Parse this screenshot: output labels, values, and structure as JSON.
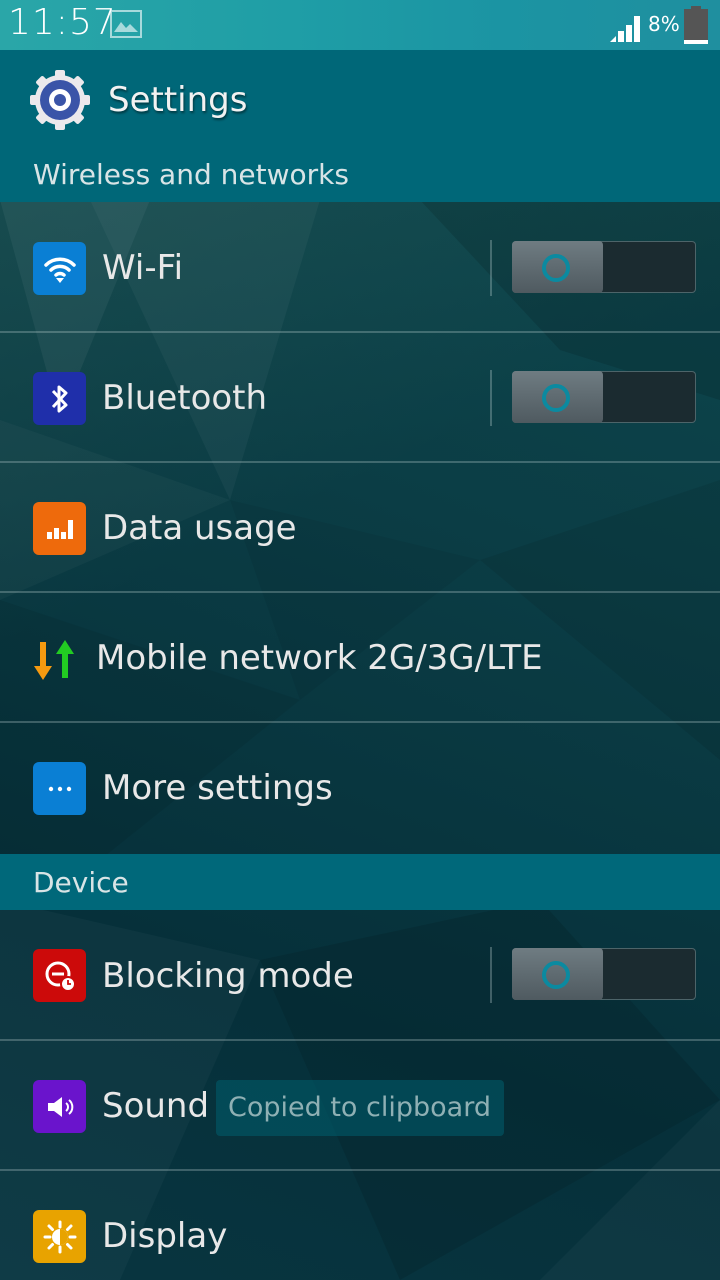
{
  "status_bar": {
    "time": "11:57",
    "notification_icon": "image-icon",
    "signal_icon": "signal-icon",
    "battery_percent": "8%",
    "battery_icon": "battery-icon"
  },
  "app_bar": {
    "icon": "gear-icon",
    "title": "Settings"
  },
  "sections": [
    {
      "header": "Wireless and networks",
      "items": [
        {
          "label": "Wi-Fi",
          "icon": "wifi-icon",
          "icon_color": "#0a7fd4",
          "toggle": true,
          "toggle_on": false
        },
        {
          "label": "Bluetooth",
          "icon": "bluetooth-icon",
          "icon_color": "#1f2faa",
          "toggle": true,
          "toggle_on": false
        },
        {
          "label": "Data usage",
          "icon": "data-usage-icon",
          "icon_color": "#ee6a0c",
          "toggle": false
        },
        {
          "label": "Mobile network 2G/3G/LTE",
          "icon": "up-down-arrows-icon",
          "toggle": false
        },
        {
          "label": "More settings",
          "icon": "more-icon",
          "icon_color": "#0a7fd4",
          "toggle": false
        }
      ]
    },
    {
      "header": "Device",
      "items": [
        {
          "label": "Blocking mode",
          "icon": "blocking-mode-icon",
          "icon_color": "#cc0a0a",
          "toggle": true,
          "toggle_on": false
        },
        {
          "label": "Sound",
          "icon": "sound-icon",
          "icon_color": "#6a14cc",
          "toggle": false
        },
        {
          "label": "Display",
          "icon": "display-icon",
          "icon_color": "#e8a300",
          "toggle": false
        }
      ]
    }
  ],
  "toast": {
    "text": "Copied to clipboard"
  }
}
